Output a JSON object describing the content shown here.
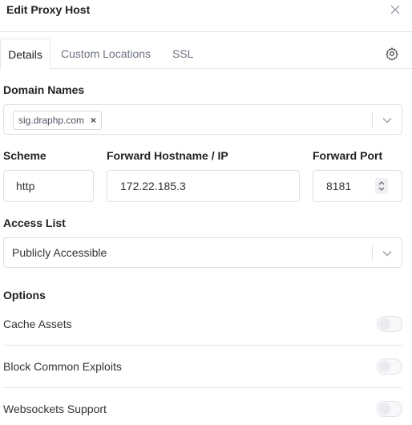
{
  "header": {
    "title": "Edit Proxy Host",
    "close_icon": "close-icon"
  },
  "tabs": [
    {
      "label": "Details",
      "active": true
    },
    {
      "label": "Custom Locations",
      "active": false
    },
    {
      "label": "SSL",
      "active": false
    }
  ],
  "settings_icon": "gear-icon",
  "domain_names": {
    "label": "Domain Names",
    "chips": [
      "sig.draphp.com"
    ],
    "chip_remove": "×"
  },
  "scheme": {
    "label": "Scheme",
    "value": "http"
  },
  "forward_host": {
    "label": "Forward Hostname / IP",
    "value": "172.22.185.3"
  },
  "forward_port": {
    "label": "Forward Port",
    "value": "8181"
  },
  "access_list": {
    "label": "Access List",
    "value": "Publicly Accessible"
  },
  "options": {
    "label": "Options",
    "items": [
      {
        "label": "Cache Assets",
        "enabled": false
      },
      {
        "label": "Block Common Exploits",
        "enabled": false
      },
      {
        "label": "Websockets Support",
        "enabled": false
      }
    ]
  },
  "colors": {
    "border": "#dde0e5",
    "text": "#222222",
    "muted": "#6c7382"
  }
}
